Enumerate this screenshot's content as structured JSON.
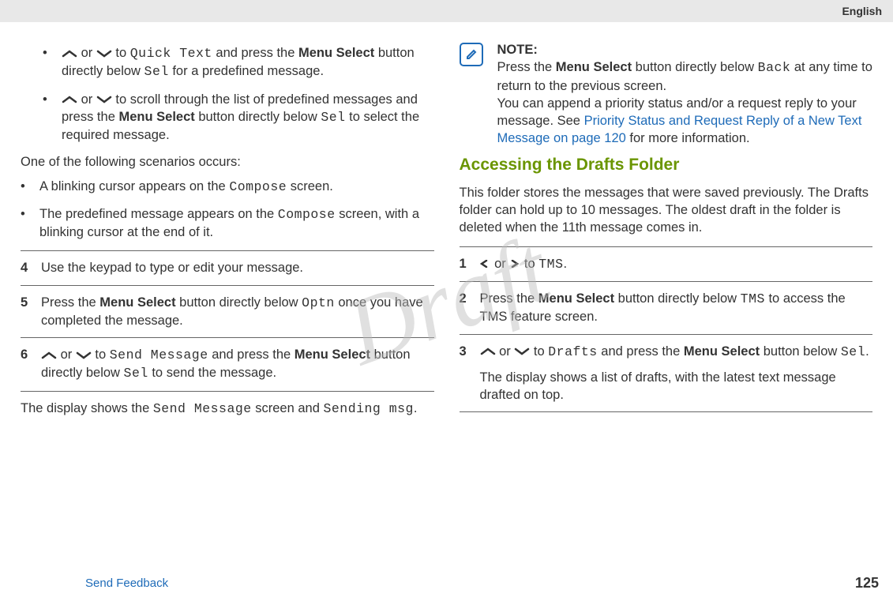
{
  "header": {
    "lang": "English"
  },
  "watermark": "Draft",
  "left": {
    "bullet1_a": " or ",
    "bullet1_b": " to ",
    "bullet1_qt": "Quick Text",
    "bullet1_c": " and press the ",
    "bullet1_ms": "Menu Select",
    "bullet1_d": " button directly below ",
    "bullet1_sel": "Sel",
    "bullet1_e": " for a predefined message.",
    "bullet2_a": " or ",
    "bullet2_b": " to scroll through the list of predefined messages and press the ",
    "bullet2_ms": "Menu Select",
    "bullet2_c": " button directly below ",
    "bullet2_sel": "Sel",
    "bullet2_d": " to select the required message.",
    "scenario": "One of the following scenarios occurs:",
    "sc1_a": "A blinking cursor appears on the ",
    "sc1_comp": "Compose",
    "sc1_b": " screen.",
    "sc2_a": "The predefined message appears on the ",
    "sc2_comp": "Compose",
    "sc2_b": " screen, with a blinking cursor at the end of it.",
    "step4_num": "4",
    "step4": "Use the keypad to type or edit your message.",
    "step5_num": "5",
    "step5_a": "Press the ",
    "step5_ms": "Menu Select",
    "step5_b": " button directly below ",
    "step5_optn": "Optn",
    "step5_c": " once you have completed the message.",
    "step6_num": "6",
    "step6_a": " or ",
    "step6_b": " to ",
    "step6_sm": "Send Message",
    "step6_c": " and press the ",
    "step6_ms": "Menu Select",
    "step6_d": " button directly below ",
    "step6_sel": "Sel",
    "step6_e": " to send the message.",
    "tail_a": "The display shows the ",
    "tail_sm": "Send Message",
    "tail_b": " screen and ",
    "tail_sending": "Sending msg",
    "tail_c": "."
  },
  "right": {
    "note_title": "NOTE:",
    "note_a": "Press the ",
    "note_ms": "Menu Select",
    "note_b": " button directly below ",
    "note_back": "Back",
    "note_c": " at any time to return to the previous screen.",
    "note_d": "You can append a priority status and/or a request reply to your message. See ",
    "note_link": "Priority Status and Request Reply of a New Text Message on page 120",
    "note_e": " for more information.",
    "section": "Accessing the Drafts Folder",
    "intro": "This folder stores the messages that were saved previously. The Drafts folder can hold up to 10 messages. The oldest draft in the folder is deleted when the 11th message comes in.",
    "s1_num": "1",
    "s1_a": " or ",
    "s1_b": " to ",
    "s1_tms": "TMS",
    "s1_c": ".",
    "s2_num": "2",
    "s2_a": "Press the ",
    "s2_ms": "Menu Select",
    "s2_b": " button directly below ",
    "s2_tms": "TMS",
    "s2_c": " to access the TMS feature screen.",
    "s3_num": "3",
    "s3_a": " or ",
    "s3_b": " to ",
    "s3_dr": "Drafts",
    "s3_c": " and press the ",
    "s3_ms": "Menu Select",
    "s3_d": " button below ",
    "s3_sel": "Sel",
    "s3_e": ".",
    "s3_tail": "The display shows a list of drafts, with the latest text message drafted on top."
  },
  "footer": {
    "send": "Send Feedback",
    "page": "125"
  }
}
